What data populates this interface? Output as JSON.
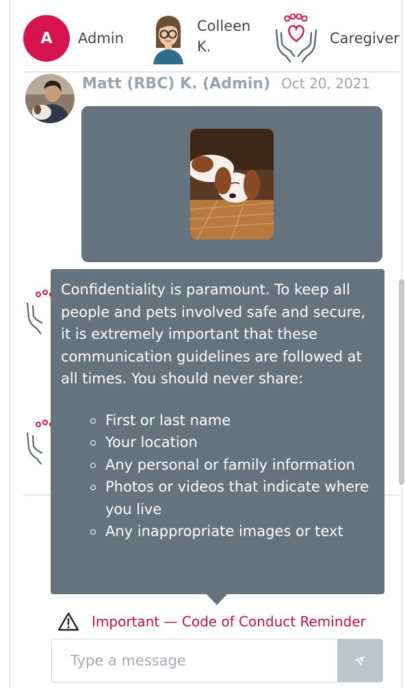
{
  "participants": [
    {
      "avatar_letter": "A",
      "label": "Admin",
      "avatar_color": "#d7134f"
    },
    {
      "label": "Colleen K.",
      "avatar_icon": "woman-with-glasses-avatar-icon"
    },
    {
      "label": "Caregiver",
      "avatar_icon": "paw-heart-hands-icon"
    }
  ],
  "message": {
    "author": "Matt (RBC) K. (Admin)",
    "date": "Oct 20, 2021",
    "attachment": "dog-photo"
  },
  "tooltip": {
    "intro": "Confidentiality is paramount. To keep all people and pets involved safe and secure, it is extremely important that these communication guidelines are followed at all times. You should never share:",
    "items": [
      "First or last name",
      "Your location",
      "Any personal or family information",
      "Photos or videos that indicate where you live",
      "Any inappropriate images or text"
    ]
  },
  "reminder": {
    "icon": "warning-triangle-icon",
    "label": "Important — Code of Conduct Reminder"
  },
  "composer": {
    "placeholder": "Type a message",
    "send_icon": "send-icon"
  },
  "colors": {
    "accent": "#d7134f",
    "bubble": "#65737e",
    "send_button": "#b9c6ce"
  }
}
